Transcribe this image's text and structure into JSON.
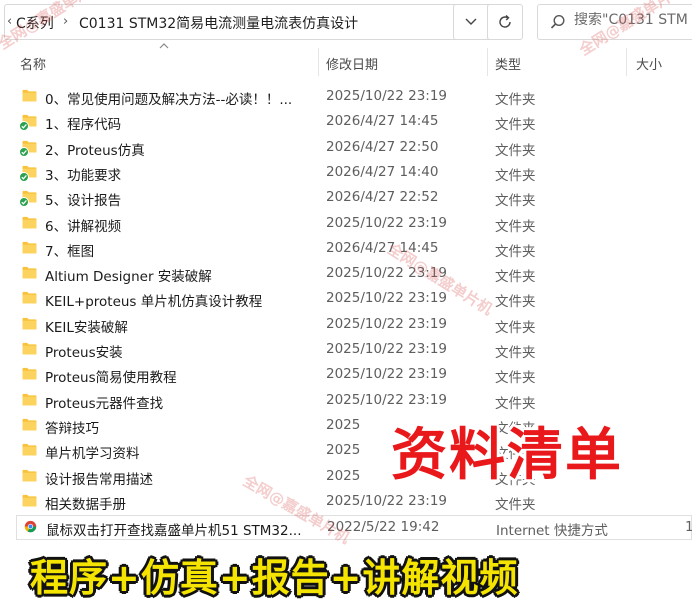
{
  "address_bar": {
    "breadcrumbs": [
      {
        "label": "C系列"
      },
      {
        "label": "C0131 STM32简易电流测量电流表仿真设计"
      }
    ]
  },
  "search": {
    "placeholder": "搜索\"C0131 STM"
  },
  "columns": {
    "name": "名称",
    "date": "修改日期",
    "type": "类型",
    "size": "大小"
  },
  "files": [
    {
      "name": "0、常见使用问题及解决方法--必读！！...",
      "date": "2025/10/22 23:19",
      "type": "文件夹",
      "size": "",
      "icon": "folder-icon",
      "sync": false
    },
    {
      "name": "1、程序代码",
      "date": "2026/4/27 14:45",
      "type": "文件夹",
      "size": "",
      "icon": "folder-icon",
      "sync": true
    },
    {
      "name": "2、Proteus仿真",
      "date": "2026/4/27 22:50",
      "type": "文件夹",
      "size": "",
      "icon": "folder-icon",
      "sync": true
    },
    {
      "name": "3、功能要求",
      "date": "2026/4/27 14:40",
      "type": "文件夹",
      "size": "",
      "icon": "folder-icon",
      "sync": true
    },
    {
      "name": "5、设计报告",
      "date": "2026/4/27 22:52",
      "type": "文件夹",
      "size": "",
      "icon": "folder-icon",
      "sync": true
    },
    {
      "name": "6、讲解视频",
      "date": "2025/10/22 23:19",
      "type": "文件夹",
      "size": "",
      "icon": "folder-icon",
      "sync": false
    },
    {
      "name": "7、框图",
      "date": "2026/4/27 14:45",
      "type": "文件夹",
      "size": "",
      "icon": "folder-icon",
      "sync": false
    },
    {
      "name": "Altium Designer 安装破解",
      "date": "2025/10/22 23:19",
      "type": "文件夹",
      "size": "",
      "icon": "folder-icon",
      "sync": false
    },
    {
      "name": "KEIL+proteus 单片机仿真设计教程",
      "date": "2025/10/22 23:19",
      "type": "文件夹",
      "size": "",
      "icon": "folder-icon",
      "sync": false
    },
    {
      "name": "KEIL安装破解",
      "date": "2025/10/22 23:19",
      "type": "文件夹",
      "size": "",
      "icon": "folder-icon",
      "sync": false
    },
    {
      "name": "Proteus安装",
      "date": "2025/10/22 23:19",
      "type": "文件夹",
      "size": "",
      "icon": "folder-icon",
      "sync": false
    },
    {
      "name": "Proteus简易使用教程",
      "date": "2025/10/22 23:19",
      "type": "文件夹",
      "size": "",
      "icon": "folder-icon",
      "sync": false
    },
    {
      "name": "Proteus元器件查找",
      "date": "2025/10/22 23:19",
      "type": "文件夹",
      "size": "",
      "icon": "folder-icon",
      "sync": false
    },
    {
      "name": "答辩技巧",
      "date": "2025",
      "type": "文件夹",
      "size": "",
      "icon": "folder-icon",
      "sync": false
    },
    {
      "name": "单片机学习资料",
      "date": "2025",
      "type": "文件夹",
      "size": "",
      "icon": "folder-icon",
      "sync": false
    },
    {
      "name": "设计报告常用描述",
      "date": "2025",
      "type": "文件夹",
      "size": "",
      "icon": "folder-icon",
      "sync": false
    },
    {
      "name": "相关数据手册",
      "date": "2025/10/22 23:19",
      "type": "文件夹",
      "size": "",
      "icon": "folder-icon",
      "sync": false
    },
    {
      "name": "鼠标双击打开查找嘉盛单片机51 STM32...",
      "date": "2022/5/22 19:42",
      "type": "Internet 快捷方式",
      "size": "1",
      "icon": "chrome-shortcut-icon",
      "sync": false
    }
  ],
  "overlays": {
    "red_caption": "资料清单",
    "yellow_caption": "程序+仿真+报告+讲解视频"
  },
  "watermark_text": "全网@嘉盛单片机",
  "colors": {
    "folder": "#f8c33a",
    "sync_badge": "#2aa14f",
    "red_caption": "#e8181b",
    "yellow_caption": "#f5e400"
  }
}
